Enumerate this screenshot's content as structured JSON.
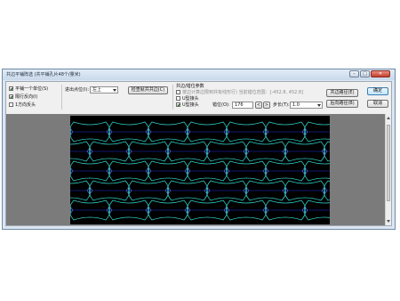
{
  "window": {
    "title": "共边平铺阵选 (共平铺孔片48个/量米)",
    "min_label": "–",
    "max_label": "□",
    "close_label": "✕"
  },
  "left_options": [
    {
      "label": "平铺一个单位(S)",
      "checked": true
    },
    {
      "label": "隔行反向(I)",
      "checked": true
    },
    {
      "label": "1方向反头",
      "checked": false
    }
  ],
  "start_point": {
    "label": "进出点位(I):",
    "value": "左上"
  },
  "buttons": {
    "common_edge_check": "检查就共共边(C)",
    "common_edge_path": "共边路径(E)",
    "rear_common_path": "后向路径(B)",
    "confirm": "确定",
    "cancel": "取消"
  },
  "common_edge_params": {
    "group_title": "共边/错位参数",
    "auto_calc_label": "按边计算边限到共有线形行)  当前错位范围：[-452.8, 452.8]",
    "auto_calc_checked": false,
    "option_a": {
      "label": "U型接头",
      "checked": false
    },
    "option_b": {
      "label": "U型接头",
      "checked": true
    },
    "offset_label": "错位(O):",
    "offset_value": "176",
    "step_label": "步长(T):",
    "step_value": "1.0"
  },
  "colors": {
    "canvas_bg": "#000000",
    "shape_stroke": "#2fd0c6",
    "node_stroke": "#6f74e8",
    "guide_line": "#1f33d8"
  }
}
